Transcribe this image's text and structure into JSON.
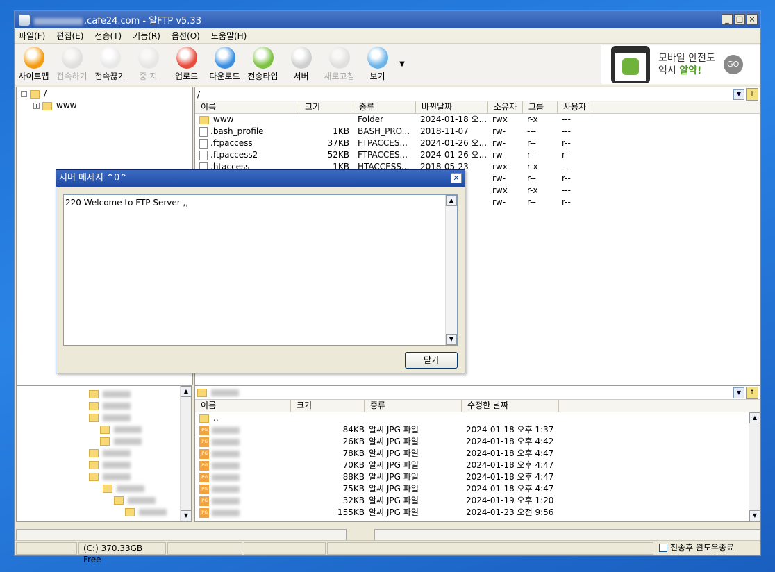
{
  "window": {
    "title_suffix": ".cafe24.com - 알FTP v5.33",
    "minimize": "_",
    "maximize": "□",
    "close": "×"
  },
  "menu": [
    "파일(F)",
    "편집(E)",
    "전송(T)",
    "기능(R)",
    "옵션(O)",
    "도움말(H)"
  ],
  "toolbar": [
    {
      "label": "사이트맵",
      "icon": "sitemap-icon",
      "enabled": true
    },
    {
      "label": "접속하기",
      "icon": "connect-icon",
      "enabled": false
    },
    {
      "label": "접속끊기",
      "icon": "disconnect-icon",
      "enabled": true
    },
    {
      "label": "중 지",
      "icon": "stop-icon",
      "enabled": false
    },
    {
      "label": "업로드",
      "icon": "upload-icon",
      "enabled": true
    },
    {
      "label": "다운로드",
      "icon": "download-icon",
      "enabled": true
    },
    {
      "label": "전송타입",
      "icon": "transfer-type-icon",
      "enabled": true
    },
    {
      "label": "서버",
      "icon": "server-icon",
      "enabled": true
    },
    {
      "label": "새로고침",
      "icon": "refresh-icon",
      "enabled": false
    },
    {
      "label": "보기",
      "icon": "view-icon",
      "enabled": true
    }
  ],
  "ad": {
    "line1": "모바일 안전도",
    "line2_prefix": "역시 ",
    "line2_highlight": "알약!",
    "go": "GO"
  },
  "remote": {
    "tree": {
      "root": "/",
      "child": "www"
    },
    "path": "/",
    "columns": [
      "이름",
      "크기",
      "종류",
      "바뀐날짜",
      "소유자",
      "그룹",
      "사용자"
    ],
    "files": [
      {
        "name": "www",
        "size": "",
        "type": "Folder",
        "date": "2024-01-18 오...",
        "owner": "rwx",
        "group": "r-x",
        "user": "---",
        "folder": true
      },
      {
        "name": ".bash_profile",
        "size": "1KB",
        "type": "BASH_PRO...",
        "date": "2018-11-07",
        "owner": "rw-",
        "group": "---",
        "user": "---",
        "folder": false
      },
      {
        "name": ".ftpaccess",
        "size": "37KB",
        "type": "FTPACCES...",
        "date": "2024-01-26 오...",
        "owner": "rw-",
        "group": "r--",
        "user": "r--",
        "folder": false
      },
      {
        "name": ".ftpaccess2",
        "size": "52KB",
        "type": "FTPACCES...",
        "date": "2024-01-26 오...",
        "owner": "rw-",
        "group": "r--",
        "user": "r--",
        "folder": false
      },
      {
        "name": ".htaccess",
        "size": "1KB",
        "type": "HTACCESS...",
        "date": "2018-05-23",
        "owner": "rwx",
        "group": "r-x",
        "user": "---",
        "folder": false
      },
      {
        "name": "",
        "size": "",
        "type": "",
        "date": "",
        "owner": "rw-",
        "group": "r--",
        "user": "r--",
        "folder": false
      },
      {
        "name": "",
        "size": "",
        "type": "",
        "date": "",
        "owner": "rwx",
        "group": "r-x",
        "user": "---",
        "folder": false
      },
      {
        "name": "",
        "size": "",
        "type": "",
        "date": "",
        "owner": "rw-",
        "group": "r--",
        "user": "r--",
        "folder": false
      }
    ]
  },
  "dialog": {
    "title": "서버 메세지 ^0^",
    "message": "220 Welcome to FTP Server ,,",
    "close_button": "닫기"
  },
  "local": {
    "columns": [
      "이름",
      "크기",
      "종류",
      "수정한 날짜"
    ],
    "files": [
      {
        "name": "..",
        "size": "",
        "type": "",
        "date": ""
      },
      {
        "name": "",
        "size": "84KB",
        "type": "알씨 JPG 파일",
        "date": "2024-01-18 오후 1:37"
      },
      {
        "name": "",
        "size": "26KB",
        "type": "알씨 JPG 파일",
        "date": "2024-01-18 오후 4:42"
      },
      {
        "name": "",
        "size": "78KB",
        "type": "알씨 JPG 파일",
        "date": "2024-01-18 오후 4:47"
      },
      {
        "name": "",
        "size": "70KB",
        "type": "알씨 JPG 파일",
        "date": "2024-01-18 오후 4:47"
      },
      {
        "name": "",
        "size": "88KB",
        "type": "알씨 JPG 파일",
        "date": "2024-01-18 오후 4:47"
      },
      {
        "name": "",
        "size": "75KB",
        "type": "알씨 JPG 파일",
        "date": "2024-01-18 오후 4:47"
      },
      {
        "name": "",
        "size": "32KB",
        "type": "알씨 JPG 파일",
        "date": "2024-01-19 오후 1:20"
      },
      {
        "name": "",
        "size": "155KB",
        "type": "알씨 JPG 파일",
        "date": "2024-01-23 오전 9:56"
      }
    ]
  },
  "status": {
    "drive": "(C:)  370.33GB Free",
    "close_after_transfer": "전송후 윈도우종료"
  },
  "colors": {
    "title_bar": "#2a57b0",
    "accent_green": "#4d9a1f"
  }
}
